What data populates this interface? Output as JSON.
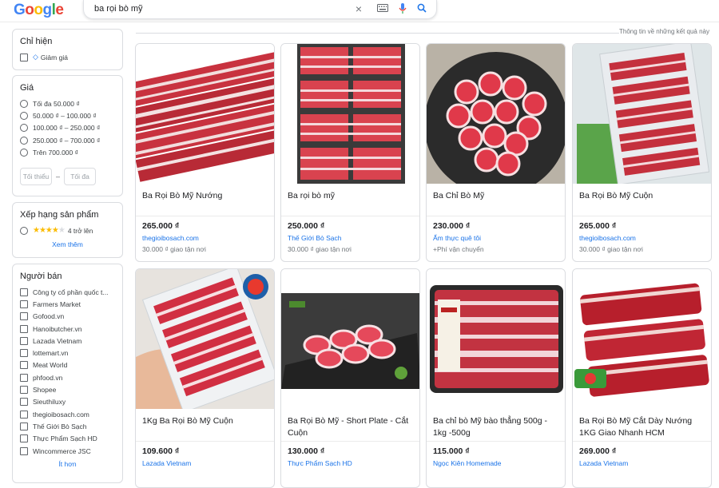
{
  "search": {
    "query": "ba rọi bò mỹ"
  },
  "info_text": "Thông tin về những kết quả này",
  "filters": {
    "show": {
      "title": "Chỉ hiện",
      "options": [
        "Giảm giá"
      ]
    },
    "price": {
      "title": "Giá",
      "options": [
        "Tối đa 50.000 ₫",
        "50.000 ₫ – 100.000 ₫",
        "100.000 ₫ – 250.000 ₫",
        "250.000 ₫ – 700.000 ₫",
        "Trên 700.000 ₫"
      ],
      "min_placeholder": "Tối thiểu",
      "max_placeholder": "Tối đa"
    },
    "rating": {
      "title": "Xếp hạng sản phẩm",
      "stars": 4,
      "label": "4 trở lên",
      "more": "Xem thêm"
    },
    "sellers": {
      "title": "Người bán",
      "options": [
        "Công ty cổ phần quốc t...",
        "Farmers Market",
        "Gofood.vn",
        "Hanoibutcher.vn",
        "Lazada Vietnam",
        "lottemart.vn",
        "Meat World",
        "phfood.vn",
        "Shopee",
        "Sieuthiluxy",
        "thegioibosach.com",
        "Thế Giới Bò Sạch",
        "Thực Phẩm Sạch HD",
        "Wincommerce JSC"
      ],
      "less": "Ít hơn"
    }
  },
  "products": [
    {
      "title": "Ba Rọi Bò Mỹ Nướng",
      "price": "265.000 ₫",
      "seller": "thegioibosach.com",
      "ship": "30.000 ₫ giao tận nơi"
    },
    {
      "title": "Ba rọi bò mỹ",
      "price": "250.000 ₫",
      "seller": "Thế Giới Bò Sạch",
      "ship": "30.000 ₫ giao tận nơi"
    },
    {
      "title": "Ba Chỉ Bò Mỹ",
      "price": "230.000 ₫",
      "seller": "Ẩm thực quê tôi",
      "ship": "+Phí vận chuyển"
    },
    {
      "title": "Ba Rọi Bò Mỹ Cuộn",
      "price": "265.000 ₫",
      "seller": "thegioibosach.com",
      "ship": "30.000 ₫ giao tận nơi"
    },
    {
      "title": "1Kg Ba Rọi Bò Mỹ Cuộn",
      "price": "109.600 ₫",
      "seller": "Lazada Vietnam",
      "ship": ""
    },
    {
      "title": "Ba Rọi Bò Mỹ - Short Plate - Cắt Cuộn",
      "price": "130.000 ₫",
      "seller": "Thực Phẩm Sạch HD",
      "ship": ""
    },
    {
      "title": "Ba chỉ bò Mỹ bào thẳng 500g - 1kg -500g",
      "price": "115.000 ₫",
      "seller": "Ngọc Kiên Homemade",
      "ship": ""
    },
    {
      "title": "Ba Rọi Bò Mỹ Cắt Dày Nướng 1KG Giao Nhanh HCM",
      "price": "269.000 ₫",
      "seller": "Lazada Vietnam",
      "ship": ""
    }
  ],
  "colors": {
    "link": "#1a73e8",
    "meat": "#c8323f",
    "fat": "#f2dede"
  }
}
